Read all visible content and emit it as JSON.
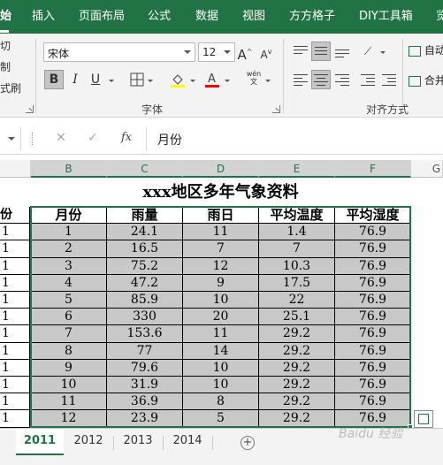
{
  "ribbon_tabs": [
    "始",
    "插入",
    "页面布局",
    "公式",
    "数据",
    "视图",
    "方方格子",
    "DIY工具箱",
    "览"
  ],
  "clipboard": {
    "cut": "切",
    "copy": "制",
    "format_painter": "式刷"
  },
  "font": {
    "name": "宋体",
    "size": "12",
    "group_label": "字体",
    "bold": "B",
    "italic": "I",
    "underline": "U"
  },
  "alignment": {
    "group_label": "对齐方式",
    "wrap_text": "自动",
    "merge": "合并"
  },
  "formula_bar": {
    "cancel": "✕",
    "enter": "✓",
    "fx": "fx",
    "value": "月份"
  },
  "columns": [
    "B",
    "C",
    "D",
    "E",
    "F",
    "G"
  ],
  "sheet": {
    "title": "xxx地区多年气象资料",
    "left_clip": [
      "份",
      "1",
      "1",
      "1",
      "1",
      "1",
      "1",
      "1",
      "1",
      "1",
      "1",
      "1",
      "1"
    ],
    "headers": [
      "月份",
      "雨量",
      "雨日",
      "平均温度",
      "平均湿度"
    ],
    "rows": [
      [
        "1",
        "24.1",
        "11",
        "1.4",
        "76.9"
      ],
      [
        "2",
        "16.5",
        "7",
        "7",
        "76.9"
      ],
      [
        "3",
        "75.2",
        "12",
        "10.3",
        "76.9"
      ],
      [
        "4",
        "47.2",
        "9",
        "17.5",
        "76.9"
      ],
      [
        "5",
        "85.9",
        "10",
        "22",
        "76.9"
      ],
      [
        "6",
        "330",
        "20",
        "25.1",
        "76.9"
      ],
      [
        "7",
        "153.6",
        "11",
        "29.2",
        "76.9"
      ],
      [
        "8",
        "77",
        "14",
        "29.2",
        "76.9"
      ],
      [
        "9",
        "79.6",
        "10",
        "29.2",
        "76.9"
      ],
      [
        "10",
        "31.9",
        "10",
        "29.2",
        "76.9"
      ],
      [
        "11",
        "36.9",
        "8",
        "29.2",
        "76.9"
      ],
      [
        "12",
        "23.9",
        "5",
        "29.2",
        "76.9"
      ]
    ]
  },
  "sheet_tabs": [
    "2011",
    "2012",
    "2013",
    "2014"
  ],
  "add_sheet": "+",
  "watermark": "Baidu 经验",
  "colors": {
    "accent": "#217346",
    "data_fill": "#c8c8c8"
  }
}
